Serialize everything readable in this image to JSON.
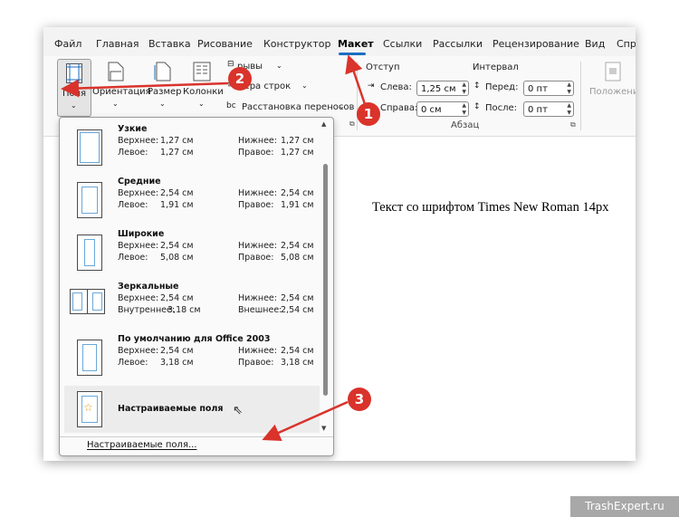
{
  "tabs": [
    "Файл",
    "Главная",
    "Вставка",
    "Рисование",
    "Конструктор",
    "Макет",
    "Ссылки",
    "Рассылки",
    "Рецензирование",
    "Вид",
    "Спр"
  ],
  "ribbon": {
    "margins_label": "Поля",
    "orientation_label": "Ориентация",
    "size_label": "Размер",
    "columns_label": "Колонки",
    "breaks_label": "рывы",
    "line_numbers_label": "мера строк",
    "hyphenation_label": "Расстановка переносов",
    "indent_label": "Отступ",
    "spacing_label": "Интервал",
    "left_label": "Слева:",
    "right_label": "Справа:",
    "before_label": "Перед:",
    "after_label": "После:",
    "left_value": "1,25 см",
    "right_value": "0 см",
    "before_value": "0 пт",
    "after_value": "0 пт",
    "paragraph_group": "Абзац",
    "position_label": "Положение"
  },
  "dropdown": {
    "options": [
      {
        "title": "Узкие",
        "l1": "Верхнее:",
        "v1": "1,27 см",
        "l2": "Нижнее:",
        "v2": "1,27 см",
        "l3": "Левое:",
        "v3": "1,27 см",
        "l4": "Правое:",
        "v4": "1,27 см"
      },
      {
        "title": "Средние",
        "l1": "Верхнее:",
        "v1": "2,54 см",
        "l2": "Нижнее:",
        "v2": "2,54 см",
        "l3": "Левое:",
        "v3": "1,91 см",
        "l4": "Правое:",
        "v4": "1,91 см"
      },
      {
        "title": "Широкие",
        "l1": "Верхнее:",
        "v1": "2,54 см",
        "l2": "Нижнее:",
        "v2": "2,54 см",
        "l3": "Левое:",
        "v3": "5,08 см",
        "l4": "Правое:",
        "v4": "5,08 см"
      },
      {
        "title": "Зеркальные",
        "l1": "Верхнее:",
        "v1": "2,54 см",
        "l2": "Нижнее:",
        "v2": "2,54 см",
        "l3": "Внутреннее:",
        "v3": "3,18 см",
        "l4": "Внешнее:",
        "v4": "2,54 см"
      },
      {
        "title": "По умолчанию для Office 2003",
        "l1": "Верхнее:",
        "v1": "2,54 см",
        "l2": "Нижнее:",
        "v2": "2,54 см",
        "l3": "Левое:",
        "v3": "3,18 см",
        "l4": "Правое:",
        "v4": "3,18 см"
      }
    ],
    "custom_title": "Настраиваемые поля",
    "footer": "Настраиваемые поля..."
  },
  "document": {
    "text": "Текст со шрифтом Times New Roman 14px"
  },
  "callouts": [
    "1",
    "2",
    "3"
  ],
  "watermark": "TrashExpert.ru",
  "colors": {
    "accent": "#1b6ec2",
    "callout": "#d9332b",
    "margin_line": "#6aa7d8"
  }
}
